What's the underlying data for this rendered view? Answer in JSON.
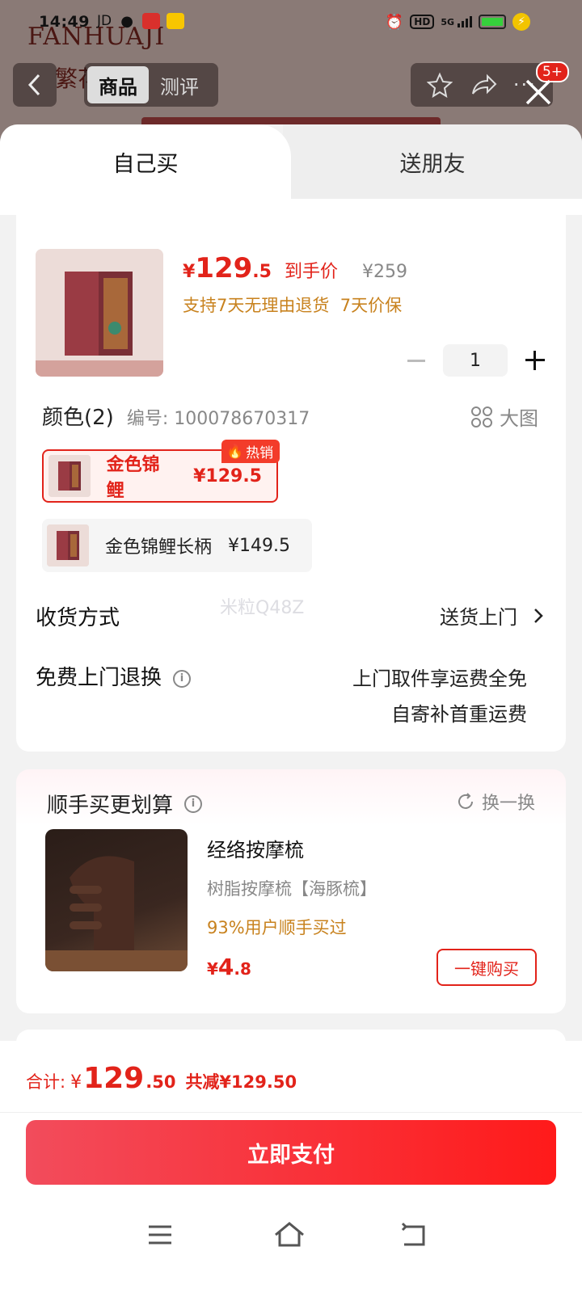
{
  "status_bar": {
    "time": "14:49",
    "carrier": "JD",
    "network": "5G",
    "hd_label": "HD"
  },
  "background": {
    "brand": "FANHUAJI",
    "brand_cn": "繁花",
    "tabs": [
      {
        "label": "商品",
        "active": true
      },
      {
        "label": "测评",
        "active": false
      }
    ],
    "badge": "5+"
  },
  "sheet": {
    "mode_tabs": [
      {
        "label": "自己买",
        "active": true
      },
      {
        "label": "送朋友",
        "active": false
      }
    ],
    "product": {
      "price_currency": "¥",
      "price_int": "129",
      "price_dec": ".5",
      "price_tag": "到手价",
      "original_price": "¥259",
      "promise": "支持7天无理由退货  7天价保",
      "quantity": "1"
    },
    "color": {
      "title": "颜色(2)",
      "code": "编号: 100078670317",
      "big_image_label": "大图",
      "hot_label": "热销",
      "options": [
        {
          "name": "金色锦鲤",
          "price": "¥129.5",
          "selected": true
        },
        {
          "name": "金色锦鲤长柄",
          "price": "¥149.5",
          "selected": false
        }
      ]
    },
    "delivery": {
      "label": "收货方式",
      "value": "送货上门"
    },
    "watermark": "米粒Q48Z",
    "returns": {
      "label": "免费上门退换",
      "line1": "上门取件享运费全免",
      "line2": "自寄补首重运费"
    },
    "addon": {
      "title": "顺手买更划算",
      "swap_label": "换一换",
      "name": "经络按摩梳",
      "subtitle": "树脂按摩梳【海豚梳】",
      "rate": "93%用户顺手买过",
      "price_currency": "¥",
      "price_int": "4",
      "price_dec": ".8",
      "buy_label": "一键购买"
    }
  },
  "footer": {
    "total_label": "合计:",
    "total_currency": "¥",
    "total_int": "129",
    "total_dec": ".50",
    "total_saved": "共减¥129.50",
    "pay_label": "立即支付"
  },
  "colors": {
    "accent_red": "#e2231a",
    "promise_orange": "#c8821e",
    "pay_gradient_start": "#f24c5c",
    "pay_gradient_end": "#ff1a1a"
  }
}
